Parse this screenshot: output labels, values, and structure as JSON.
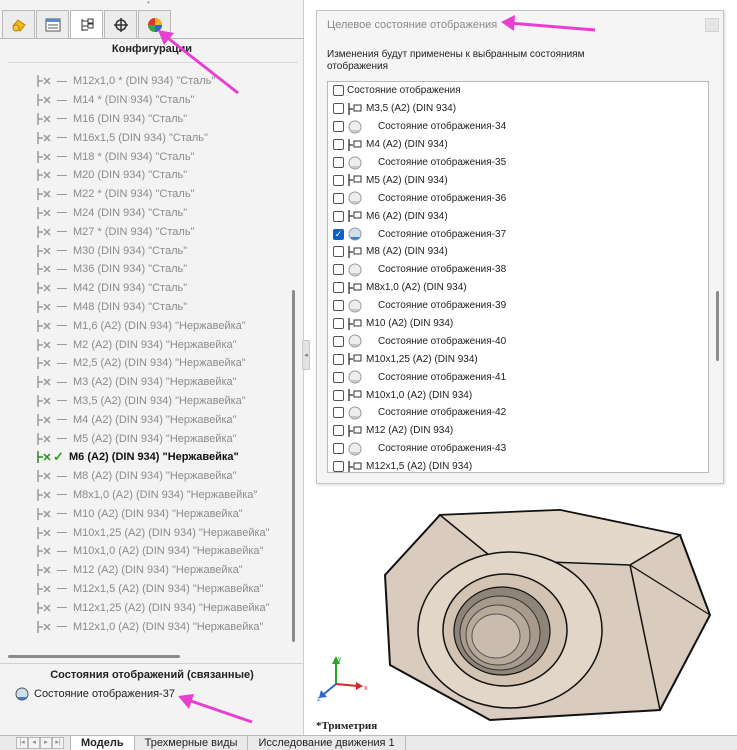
{
  "left_panel": {
    "tabs": [
      {
        "icon": "feature-manager-icon"
      },
      {
        "icon": "property-manager-icon"
      },
      {
        "icon": "configuration-manager-icon"
      },
      {
        "icon": "dimxpert-icon"
      },
      {
        "icon": "display-manager-icon"
      }
    ],
    "title": "Конфигурации",
    "configs": [
      {
        "label": "M12x1,0 * (DIN 934) \"Сталь\"",
        "active": false
      },
      {
        "label": "M14 * (DIN 934) \"Сталь\"",
        "active": false
      },
      {
        "label": "M16 (DIN 934) \"Сталь\"",
        "active": false
      },
      {
        "label": "M16x1,5 (DIN 934) \"Сталь\"",
        "active": false
      },
      {
        "label": "M18 * (DIN 934) \"Сталь\"",
        "active": false
      },
      {
        "label": "M20 (DIN 934) \"Сталь\"",
        "active": false
      },
      {
        "label": "M22 * (DIN 934) \"Сталь\"",
        "active": false
      },
      {
        "label": "M24 (DIN 934) \"Сталь\"",
        "active": false
      },
      {
        "label": "M27 * (DIN 934) \"Сталь\"",
        "active": false
      },
      {
        "label": "M30 (DIN 934) \"Сталь\"",
        "active": false
      },
      {
        "label": "M36 (DIN 934) \"Сталь\"",
        "active": false
      },
      {
        "label": "M42 (DIN 934) \"Сталь\"",
        "active": false
      },
      {
        "label": "M48 (DIN 934) \"Сталь\"",
        "active": false
      },
      {
        "label": "M1,6 (A2) (DIN 934) \"Нержавейка\"",
        "active": false
      },
      {
        "label": "M2 (A2) (DIN 934) \"Нержавейка\"",
        "active": false
      },
      {
        "label": "M2,5 (A2) (DIN 934) \"Нержавейка\"",
        "active": false
      },
      {
        "label": "M3 (A2) (DIN 934) \"Нержавейка\"",
        "active": false
      },
      {
        "label": "M3,5 (A2) (DIN 934) \"Нержавейка\"",
        "active": false
      },
      {
        "label": "M4 (A2) (DIN 934) \"Нержавейка\"",
        "active": false
      },
      {
        "label": "M5 (A2) (DIN 934) \"Нержавейка\"",
        "active": false
      },
      {
        "label": "M6 (A2) (DIN 934) \"Нержавейка\"",
        "active": true
      },
      {
        "label": "M8 (A2) (DIN 934) \"Нержавейка\"",
        "active": false
      },
      {
        "label": "M8x1,0 (A2) (DIN 934) \"Нержавейка\"",
        "active": false
      },
      {
        "label": "M10 (A2) (DIN 934) \"Нержавейка\"",
        "active": false
      },
      {
        "label": "M10x1,25 (A2) (DIN 934) \"Нержавейка\"",
        "active": false
      },
      {
        "label": "M10x1,0 (A2) (DIN 934) \"Нержавейка\"",
        "active": false
      },
      {
        "label": "M12 (A2) (DIN 934) \"Нержавейка\"",
        "active": false
      },
      {
        "label": "M12x1,5 (A2) (DIN 934) \"Нержавейка\"",
        "active": false
      },
      {
        "label": "M12x1,25 (A2) (DIN 934) \"Нержавейка\"",
        "active": false
      },
      {
        "label": "M12x1,0 (A2) (DIN 934) \"Нержавейка\"",
        "active": false
      }
    ],
    "display_states_title": "Состояния отображений (связанные)",
    "display_state_item": "Состояние отображения-37"
  },
  "dialog": {
    "title": "Целевое состояние отображения",
    "description": "Изменения будут применены к выбранным состояниям отображения",
    "items": [
      {
        "kind": "header",
        "label": "Состояние отображения",
        "checked": false
      },
      {
        "kind": "config",
        "label": "M3,5 (A2) (DIN 934)",
        "checked": false
      },
      {
        "kind": "state",
        "label": "Состояние отображения-34",
        "checked": false
      },
      {
        "kind": "config",
        "label": "M4 (A2) (DIN 934)",
        "checked": false
      },
      {
        "kind": "state",
        "label": "Состояние отображения-35",
        "checked": false
      },
      {
        "kind": "config",
        "label": "M5 (A2) (DIN 934)",
        "checked": false
      },
      {
        "kind": "state",
        "label": "Состояние отображения-36",
        "checked": false
      },
      {
        "kind": "config",
        "label": "M6 (A2) (DIN 934)",
        "checked": false
      },
      {
        "kind": "state",
        "label": "Состояние отображения-37",
        "checked": true
      },
      {
        "kind": "config",
        "label": "M8 (A2) (DIN 934)",
        "checked": false
      },
      {
        "kind": "state",
        "label": "Состояние отображения-38",
        "checked": false
      },
      {
        "kind": "config",
        "label": "M8x1,0 (A2) (DIN 934)",
        "checked": false
      },
      {
        "kind": "state",
        "label": "Состояние отображения-39",
        "checked": false
      },
      {
        "kind": "config",
        "label": "M10 (A2) (DIN 934)",
        "checked": false
      },
      {
        "kind": "state",
        "label": "Состояние отображения-40",
        "checked": false
      },
      {
        "kind": "config",
        "label": "M10x1,25 (A2) (DIN 934)",
        "checked": false
      },
      {
        "kind": "state",
        "label": "Состояние отображения-41",
        "checked": false
      },
      {
        "kind": "config",
        "label": "M10x1,0 (A2) (DIN 934)",
        "checked": false
      },
      {
        "kind": "state",
        "label": "Состояние отображения-42",
        "checked": false
      },
      {
        "kind": "config",
        "label": "M12 (A2) (DIN 934)",
        "checked": false
      },
      {
        "kind": "state",
        "label": "Состояние отображения-43",
        "checked": false
      },
      {
        "kind": "config",
        "label": "M12x1,5 (A2) (DIN 934)",
        "checked": false
      }
    ]
  },
  "viewport": {
    "view_label": "*Триметрия",
    "triad_axes": [
      "y",
      "x",
      "z"
    ]
  },
  "bottom_tabs": [
    {
      "label": "Модель",
      "active": true
    },
    {
      "label": "Трехмерные виды",
      "active": false
    },
    {
      "label": "Исследование движения 1",
      "active": false
    }
  ],
  "colors": {
    "arrow": "#e83fd0",
    "checkbox_on": "#0b62c4",
    "check_green": "#2aa52a",
    "nut_fill": "#d9cbbd"
  }
}
